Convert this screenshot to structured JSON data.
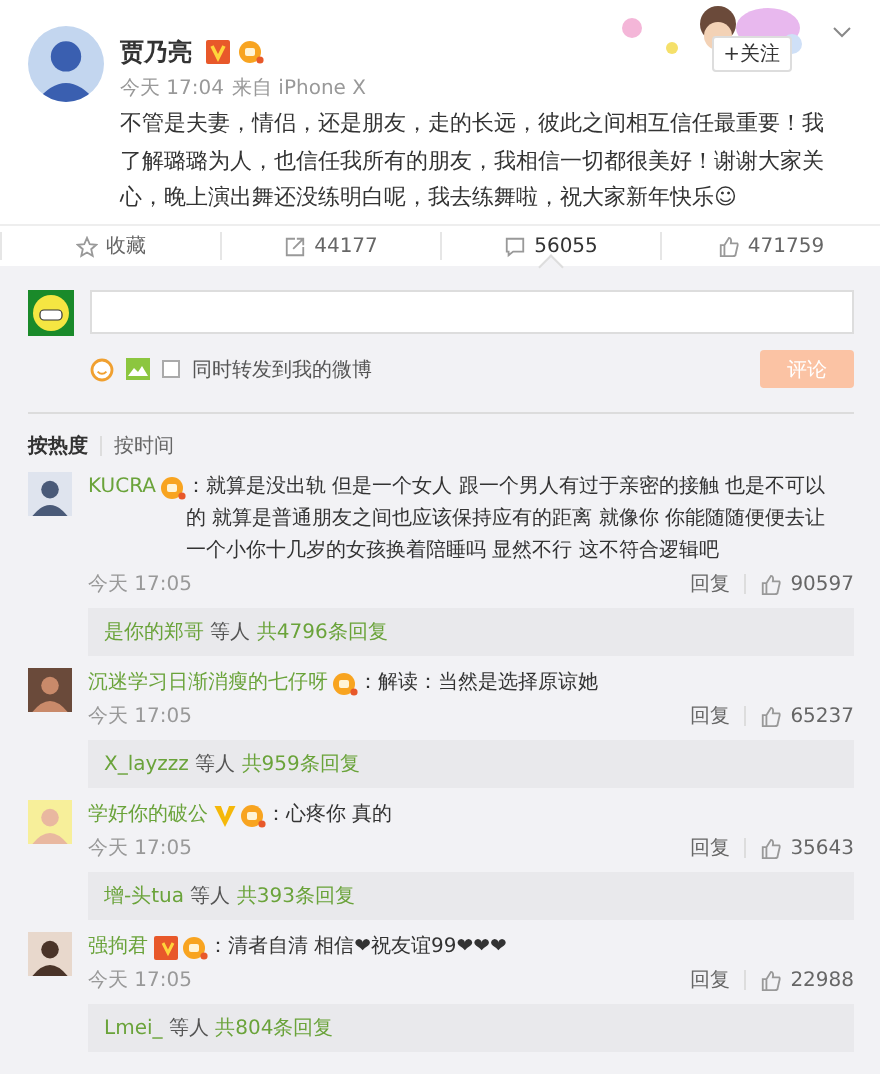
{
  "post": {
    "author": "贾乃亮",
    "verified_badge": {
      "color": "#e8582a"
    },
    "member": true,
    "time": "今天 17:04",
    "source": "来自 iPhone X",
    "text": "不管是夫妻，情侣，还是朋友，走的长远，彼此之间相互信任最重要！我了解璐璐为人，也信任我所有的朋友，我相信一切都很美好！谢谢大家关心，晚上演出舞还没练明白呢，我去练舞啦，祝大家新年快乐☺",
    "follow_button": "+关注"
  },
  "actions": [
    {
      "kind": "favorite",
      "label": "收藏",
      "selected": false
    },
    {
      "kind": "repost",
      "label": "44177",
      "selected": false
    },
    {
      "kind": "comment",
      "label": "56055",
      "selected": true
    },
    {
      "kind": "like",
      "label": "471759",
      "selected": false
    }
  ],
  "composer": {
    "sync_label": "同时转发到我的微博",
    "sync_checked": false,
    "submit": "评论",
    "submit_disabled": true
  },
  "sort_tabs": [
    {
      "label": "按热度",
      "selected": true
    },
    {
      "label": "按时间",
      "selected": false
    }
  ],
  "comments": [
    {
      "user": "KUCRA",
      "member": true,
      "text": "：就算是没出轨 但是一个女人 跟一个男人有过于亲密的接触 也是不可以的 就算是普通朋友之间也应该保持应有的距离 就像你 你能随随便便去让一个小你十几岁的女孩换着陪睡吗 显然不行 这不符合逻辑吧",
      "time": "今天 17:05",
      "reply": "回复",
      "likes": "90597",
      "replier": "是你的郑哥",
      "replier_suffix": "等人",
      "reply_count": "共4796条回复"
    },
    {
      "user": "沉迷学习日渐消瘦的七仔呀",
      "member": true,
      "text": "：解读：当然是选择原谅她",
      "time": "今天 17:05",
      "reply": "回复",
      "likes": "65237",
      "replier": "X_layzzz",
      "replier_suffix": "等人",
      "reply_count": "共959条回复"
    },
    {
      "user": "学好你的破公",
      "verified_badge": {
        "color": "#f5b80a"
      },
      "member": true,
      "text": "：心疼你 真的",
      "time": "今天 17:05",
      "reply": "回复",
      "likes": "35643",
      "replier": "增-头tua",
      "replier_suffix": "等人",
      "reply_count": "共393条回复"
    },
    {
      "user": "强拘君",
      "verified_badge": {
        "color": "#e8582a"
      },
      "member": true,
      "text": "：清者自清 相信❤祝友谊99❤❤❤",
      "time": "今天 17:05",
      "reply": "回复",
      "likes": "22988",
      "replier": "Lmei_",
      "replier_suffix": "等人",
      "reply_count": "共804条回复"
    }
  ]
}
